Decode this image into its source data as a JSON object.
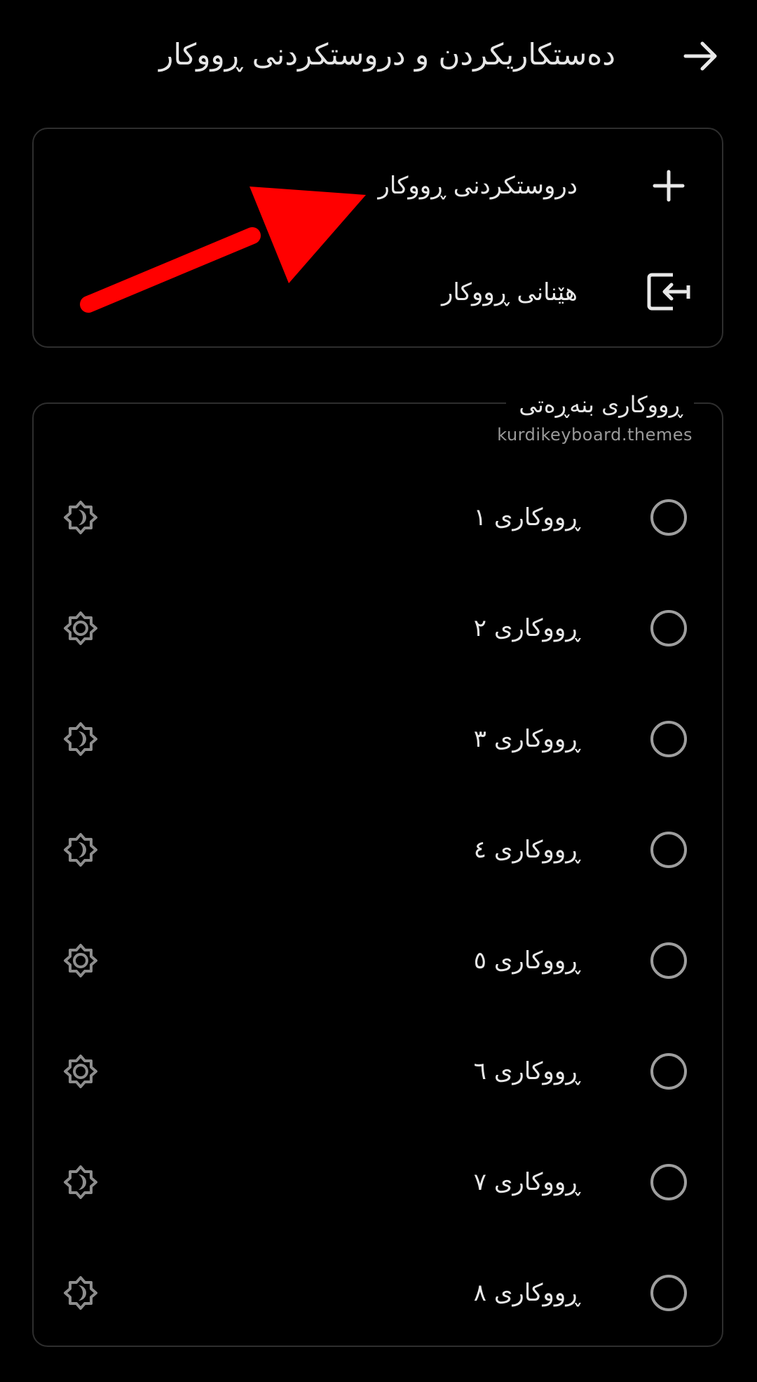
{
  "header": {
    "title": "دەستکاریکردن و دروستکردنی ڕووکار",
    "back_icon": "arrow-right-icon"
  },
  "actions": [
    {
      "label": "دروستکردنی ڕووکار",
      "icon": "plus-icon"
    },
    {
      "label": "هێنانی ڕووکار",
      "icon": "import-icon"
    }
  ],
  "themes_section": {
    "title": "ڕووکاری بنەڕەتی",
    "package": "kurdikeyboard.themes",
    "items": [
      {
        "label": "ڕووکاری ١",
        "mode_icon": "dark-mode-icon",
        "selected": false
      },
      {
        "label": "ڕووکاری ٢",
        "mode_icon": "light-mode-icon",
        "selected": false
      },
      {
        "label": "ڕووکاری ٣",
        "mode_icon": "dark-mode-icon",
        "selected": false
      },
      {
        "label": "ڕووکاری ٤",
        "mode_icon": "dark-mode-icon",
        "selected": false
      },
      {
        "label": "ڕووکاری ٥",
        "mode_icon": "light-mode-icon",
        "selected": false
      },
      {
        "label": "ڕووکاری ٦",
        "mode_icon": "light-mode-icon",
        "selected": false
      },
      {
        "label": "ڕووکاری ٧",
        "mode_icon": "dark-mode-icon",
        "selected": false
      },
      {
        "label": "ڕووکاری ٨",
        "mode_icon": "dark-mode-icon",
        "selected": false
      }
    ]
  },
  "annotation": {
    "type": "red-arrow",
    "color": "#ff0000",
    "points_to": "create-theme-button"
  },
  "colors": {
    "background": "#000000",
    "text": "#e8e8e8",
    "muted_text": "#9a9a9a",
    "border": "#2e2e2e",
    "radio": "#9e9e9e"
  }
}
